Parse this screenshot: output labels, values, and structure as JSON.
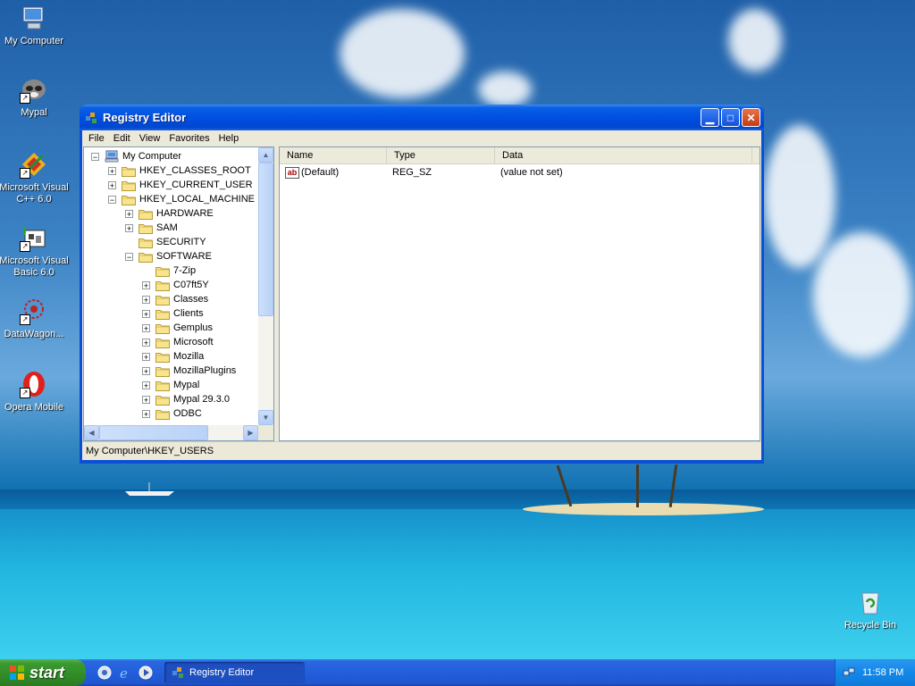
{
  "desktop": {
    "icons": [
      {
        "label": "My Computer",
        "icon": "my-computer-icon"
      },
      {
        "label": "Mypal",
        "icon": "mypal-icon"
      },
      {
        "label": "Microsoft Visual C++ 6.0",
        "icon": "visual-cpp-icon"
      },
      {
        "label": "Microsoft Visual Basic 6.0",
        "icon": "visual-basic-icon"
      },
      {
        "label": "DataWagon...",
        "icon": "datawagon-icon"
      },
      {
        "label": "Opera Mobile",
        "icon": "opera-icon"
      },
      {
        "label": "Recycle Bin",
        "icon": "recycle-bin-icon"
      }
    ]
  },
  "window": {
    "title": "Registry Editor",
    "menu": [
      "File",
      "Edit",
      "View",
      "Favorites",
      "Help"
    ],
    "tree": [
      {
        "label": "My Computer",
        "expander": "−",
        "depth": 0,
        "icon": "computer"
      },
      {
        "label": "HKEY_CLASSES_ROOT",
        "expander": "+",
        "depth": 1
      },
      {
        "label": "HKEY_CURRENT_USER",
        "expander": "+",
        "depth": 1
      },
      {
        "label": "HKEY_LOCAL_MACHINE",
        "expander": "−",
        "depth": 1
      },
      {
        "label": "HARDWARE",
        "expander": "+",
        "depth": 2
      },
      {
        "label": "SAM",
        "expander": "+",
        "depth": 2
      },
      {
        "label": "SECURITY",
        "expander": "",
        "depth": 2
      },
      {
        "label": "SOFTWARE",
        "expander": "−",
        "depth": 2
      },
      {
        "label": "7-Zip",
        "expander": "",
        "depth": 3
      },
      {
        "label": "C07ft5Y",
        "expander": "+",
        "depth": 3
      },
      {
        "label": "Classes",
        "expander": "+",
        "depth": 3
      },
      {
        "label": "Clients",
        "expander": "+",
        "depth": 3
      },
      {
        "label": "Gemplus",
        "expander": "+",
        "depth": 3
      },
      {
        "label": "Microsoft",
        "expander": "+",
        "depth": 3
      },
      {
        "label": "Mozilla",
        "expander": "+",
        "depth": 3
      },
      {
        "label": "MozillaPlugins",
        "expander": "+",
        "depth": 3
      },
      {
        "label": "Mypal",
        "expander": "+",
        "depth": 3
      },
      {
        "label": "Mypal 29.3.0",
        "expander": "+",
        "depth": 3
      },
      {
        "label": "ODBC",
        "expander": "+",
        "depth": 3
      }
    ],
    "list": {
      "columns": [
        "Name",
        "Type",
        "Data"
      ],
      "rows": [
        {
          "name": "(Default)",
          "type": "REG_SZ",
          "data": "(value not set)"
        }
      ]
    },
    "status": "My Computer\\HKEY_USERS"
  },
  "taskbar": {
    "start_label": "start",
    "task_label": "Registry Editor",
    "clock": "11:58 PM"
  },
  "colors": {
    "title_blue": "#0050e0",
    "start_green": "#318c28",
    "taskbar_blue": "#245edb"
  }
}
